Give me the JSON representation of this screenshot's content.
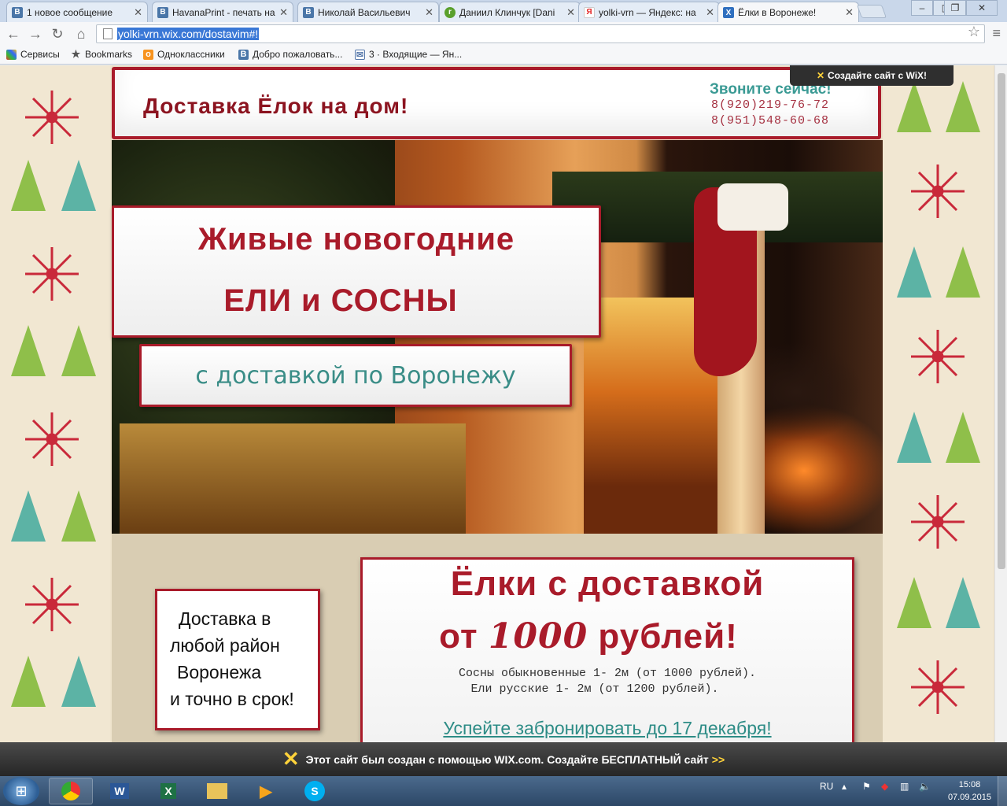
{
  "browser": {
    "tabs": [
      {
        "label": "1 новое сообщение",
        "icon": "vk-icon",
        "color": "#4a76a8"
      },
      {
        "label": "HavanaPrint - печать на",
        "icon": "vk-icon",
        "color": "#4a76a8"
      },
      {
        "label": "Николай Васильевич",
        "icon": "vk-icon",
        "color": "#4a76a8"
      },
      {
        "label": "Даниил Клинчук [Dani",
        "icon": "ru-icon",
        "color": "#5aa02c"
      },
      {
        "label": "yolki-vrn — Яндекс: на",
        "icon": "yandex-icon",
        "color": "#e32323"
      },
      {
        "label": "Ёлки в Воронеже!",
        "icon": "wix-icon",
        "color": "#2f6fbf"
      }
    ],
    "url": "yolki-vrn.wix.com/dostavim#!",
    "bookmarks": [
      "Сервисы",
      "Bookmarks",
      "Одноклассники",
      "Добро пожаловать...",
      "3 · Входящие — Ян..."
    ]
  },
  "site": {
    "title": "Доставка  Ёлок  на  дом!",
    "call_title": "Звоните сейчас!",
    "phones": [
      "8(920)219-76-72",
      "8(951)548-60-68"
    ],
    "wix_create": "Создайте сайт с WiX!",
    "banner": [
      "Живые  новогодние",
      "ЕЛИ  и  СОСНЫ"
    ],
    "subbanner": "с доставкой по Воронежу",
    "note": [
      "Доставка в",
      "любой район",
      "Воронежа",
      "и точно в срок!"
    ],
    "offer": {
      "line1": "Ёлки  с  доставкой",
      "line2_prefix": "от ",
      "price": "1000",
      "line2_suffix": " рублей!",
      "details": [
        "Сосны обыкновенные 1- 2м (от 1000 рублей).",
        "Ели русские 1- 2м (от 1200 рублей)."
      ],
      "link": "Успейте забронировать до 17 декабря!"
    },
    "wix_banner": "Этот сайт был создан с помощью WIX.com. Создайте БЕСПЛАТНЫЙ сайт"
  },
  "taskbar": {
    "lang": "RU",
    "time": "15:08",
    "date": "07.09.2015",
    "apps": [
      "chrome-icon",
      "word-icon",
      "excel-icon",
      "explorer-icon",
      "media-player-icon",
      "skype-icon"
    ]
  },
  "colors": {
    "accent_red": "#a91b2a",
    "teal": "#3a8d87"
  }
}
